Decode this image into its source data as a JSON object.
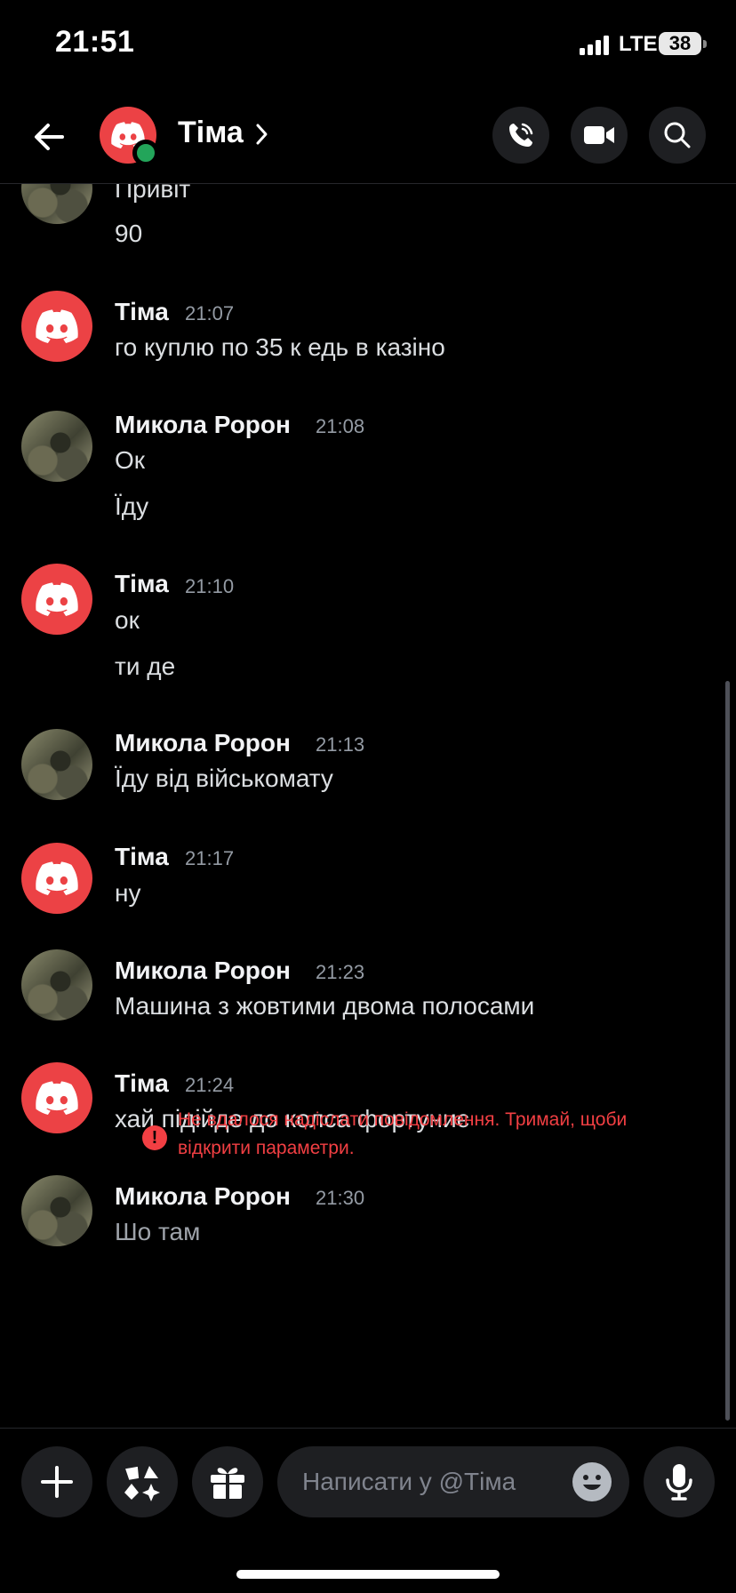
{
  "status_bar": {
    "time": "21:51",
    "network": "LTE",
    "battery": "38"
  },
  "header": {
    "title": "Tіма"
  },
  "messages": [
    {
      "id": "m0",
      "author": "",
      "time": "",
      "lines": [
        "Привіт",
        "90"
      ]
    },
    {
      "id": "m1",
      "author": "Тіма",
      "time": "21:07",
      "lines": [
        "го куплю по 35 к едь в казіно"
      ]
    },
    {
      "id": "m2",
      "author": "Микола Ророн",
      "time": "21:08",
      "lines": [
        "Ок",
        "Їду"
      ]
    },
    {
      "id": "m3",
      "author": "Тіма",
      "time": "21:10",
      "lines": [
        "ок",
        "ти де"
      ]
    },
    {
      "id": "m4",
      "author": "Микола Ророн",
      "time": "21:13",
      "lines": [
        "Їду від військомату"
      ]
    },
    {
      "id": "m5",
      "author": "Тіма",
      "time": "21:17",
      "lines": [
        "ну"
      ]
    },
    {
      "id": "m6",
      "author": "Микола Ророн",
      "time": "21:23",
      "lines": [
        "Машина з жовтими двома полосами"
      ]
    },
    {
      "id": "m7",
      "author": "Тіма",
      "time": "21:24",
      "lines": [
        "хай підійде до  колса фортуниє"
      ]
    },
    {
      "id": "m8",
      "author": "Микола Ророн",
      "time": "21:30",
      "lines": [
        "Шо там"
      ]
    }
  ],
  "error": {
    "line1": "Не вдалося надіслати повідомлення. Тримай, щоби",
    "line2": "відкрити параметри."
  },
  "composer": {
    "placeholder": "Написати у @Tіма"
  },
  "colors": {
    "discord_red": "#ec4245",
    "online_green": "#23a55a",
    "error_red": "#f23f43",
    "surface": "#1e1f22"
  }
}
